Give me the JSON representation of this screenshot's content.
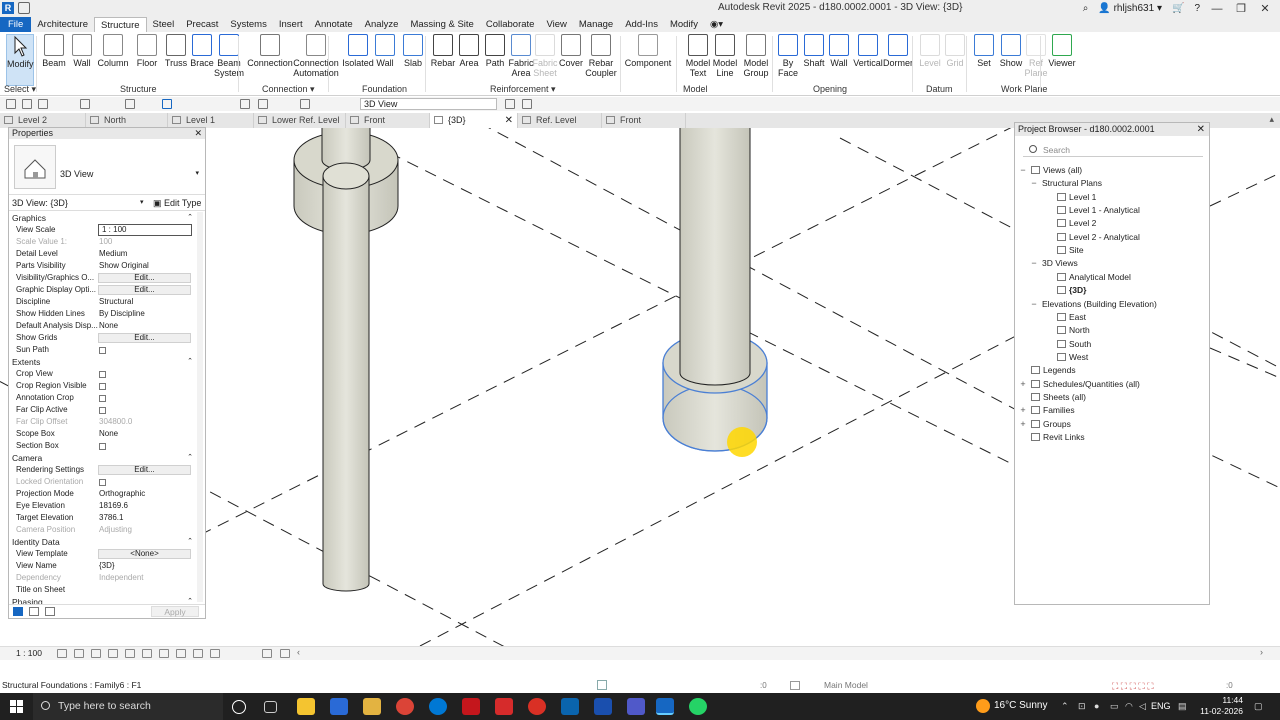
{
  "window": {
    "title": "Autodesk Revit 2025 - d180.0002.0001 - 3D View: {3D}",
    "user": "rhljsh631"
  },
  "menu": [
    "File",
    "Architecture",
    "Structure",
    "Steel",
    "Precast",
    "Systems",
    "Insert",
    "Annotate",
    "Analyze",
    "Massing & Site",
    "Collaborate",
    "View",
    "Manage",
    "Add-Ins",
    "Modify"
  ],
  "ribbon": {
    "tools": [
      {
        "label": "Modify",
        "label2": ""
      },
      {
        "label": "Beam",
        "label2": ""
      },
      {
        "label": "Wall",
        "label2": ""
      },
      {
        "label": "Column",
        "label2": ""
      },
      {
        "label": "Floor",
        "label2": ""
      },
      {
        "label": "Truss",
        "label2": ""
      },
      {
        "label": "Brace",
        "label2": ""
      },
      {
        "label": "Beam",
        "label2": "System"
      },
      {
        "label": "Connection",
        "label2": ""
      },
      {
        "label": "Connection",
        "label2": "Automation"
      },
      {
        "label": "Isolated",
        "label2": ""
      },
      {
        "label": "Wall",
        "label2": ""
      },
      {
        "label": "Slab",
        "label2": ""
      },
      {
        "label": "Rebar",
        "label2": ""
      },
      {
        "label": "Area",
        "label2": ""
      },
      {
        "label": "Path",
        "label2": ""
      },
      {
        "label": "Fabric",
        "label2": "Area"
      },
      {
        "label": "Fabric",
        "label2": "Sheet"
      },
      {
        "label": "Cover",
        "label2": ""
      },
      {
        "label": "Rebar",
        "label2": "Coupler"
      },
      {
        "label": "Component",
        "label2": ""
      },
      {
        "label": "Model",
        "label2": "Text"
      },
      {
        "label": "Model",
        "label2": "Line"
      },
      {
        "label": "Model",
        "label2": "Group"
      },
      {
        "label": "By",
        "label2": "Face"
      },
      {
        "label": "Shaft",
        "label2": ""
      },
      {
        "label": "Wall",
        "label2": ""
      },
      {
        "label": "Vertical",
        "label2": ""
      },
      {
        "label": "Dormer",
        "label2": ""
      },
      {
        "label": "Level",
        "label2": ""
      },
      {
        "label": "Grid",
        "label2": ""
      },
      {
        "label": "Set",
        "label2": ""
      },
      {
        "label": "Show",
        "label2": ""
      },
      {
        "label": "Ref",
        "label2": "Plane"
      },
      {
        "label": "Viewer",
        "label2": ""
      }
    ],
    "panels": [
      "Select",
      "Structure",
      "Connection",
      "Foundation",
      "Reinforcement",
      "Model",
      "Opening",
      "Datum",
      "Work Plane"
    ]
  },
  "quick_access": {
    "view_selector": "3D View"
  },
  "view_tabs": [
    "Level 2",
    "North",
    "Level 1",
    "Lower Ref. Level",
    "Front",
    "{3D}",
    "Ref. Level",
    "Front"
  ],
  "properties": {
    "title": "Properties",
    "type_name": "3D View",
    "instance_selector": "3D View: {3D}",
    "edit_type": "Edit Type",
    "rows": [
      {
        "kind": "group",
        "name": "Graphics"
      },
      {
        "name": "View Scale",
        "value": "1 : 100",
        "style": "input"
      },
      {
        "name": "Scale Value    1:",
        "value": "100",
        "dim": true
      },
      {
        "name": "Detail Level",
        "value": "Medium"
      },
      {
        "name": "Parts Visibility",
        "value": "Show Original"
      },
      {
        "name": "Visibility/Graphics O...",
        "value": "Edit...",
        "style": "button"
      },
      {
        "name": "Graphic Display Opti...",
        "value": "Edit...",
        "style": "button"
      },
      {
        "name": "Discipline",
        "value": "Structural"
      },
      {
        "name": "Show Hidden Lines",
        "value": "By Discipline"
      },
      {
        "name": "Default Analysis Disp...",
        "value": "None"
      },
      {
        "name": "Show Grids",
        "value": "Edit...",
        "style": "button"
      },
      {
        "name": "Sun Path",
        "value": "",
        "style": "check"
      },
      {
        "kind": "group",
        "name": "Extents"
      },
      {
        "name": "Crop View",
        "value": "",
        "style": "check"
      },
      {
        "name": "Crop Region Visible",
        "value": "",
        "style": "check"
      },
      {
        "name": "Annotation Crop",
        "value": "",
        "style": "check"
      },
      {
        "name": "Far Clip Active",
        "value": "",
        "style": "check"
      },
      {
        "name": "Far Clip Offset",
        "value": "304800.0",
        "dim": true
      },
      {
        "name": "Scope Box",
        "value": "None"
      },
      {
        "name": "Section Box",
        "value": "",
        "style": "check"
      },
      {
        "kind": "group",
        "name": "Camera"
      },
      {
        "name": "Rendering Settings",
        "value": "Edit...",
        "style": "button"
      },
      {
        "name": "Locked Orientation",
        "value": "",
        "style": "check",
        "dim": true
      },
      {
        "name": "Projection Mode",
        "value": "Orthographic"
      },
      {
        "name": "Eye Elevation",
        "value": "18169.6"
      },
      {
        "name": "Target Elevation",
        "value": "3786.1"
      },
      {
        "name": "Camera Position",
        "value": "Adjusting",
        "dim": true
      },
      {
        "kind": "group",
        "name": "Identity Data"
      },
      {
        "name": "View Template",
        "value": "<None>",
        "style": "button"
      },
      {
        "name": "View Name",
        "value": "{3D}"
      },
      {
        "name": "Dependency",
        "value": "Independent",
        "dim": true
      },
      {
        "name": "Title on Sheet",
        "value": ""
      },
      {
        "kind": "group",
        "name": "Phasing"
      }
    ],
    "apply": "Apply"
  },
  "project_browser": {
    "title": "Project Browser - d180.0002.0001",
    "search_placeholder": "Search",
    "nodes": [
      {
        "label": "Views (all)",
        "level": 0,
        "toggle": "−",
        "icon": true
      },
      {
        "label": "Structural Plans",
        "level": 1,
        "toggle": "−"
      },
      {
        "label": "Level 1",
        "level": 2,
        "icon": true
      },
      {
        "label": "Level 1 - Analytical",
        "level": 2,
        "icon": true
      },
      {
        "label": "Level 2",
        "level": 2,
        "icon": true
      },
      {
        "label": "Level 2 - Analytical",
        "level": 2,
        "icon": true
      },
      {
        "label": "Site",
        "level": 2,
        "icon": true
      },
      {
        "label": "3D Views",
        "level": 1,
        "toggle": "−"
      },
      {
        "label": "Analytical Model",
        "level": 2,
        "icon": true
      },
      {
        "label": "{3D}",
        "level": 2,
        "icon": true,
        "bold": true
      },
      {
        "label": "Elevations (Building Elevation)",
        "level": 1,
        "toggle": "−"
      },
      {
        "label": "East",
        "level": 2,
        "icon": true
      },
      {
        "label": "North",
        "level": 2,
        "icon": true
      },
      {
        "label": "South",
        "level": 2,
        "icon": true
      },
      {
        "label": "West",
        "level": 2,
        "icon": true
      },
      {
        "label": "Legends",
        "level": 0,
        "icon": true
      },
      {
        "label": "Schedules/Quantities (all)",
        "level": 0,
        "toggle": "+",
        "icon": true
      },
      {
        "label": "Sheets (all)",
        "level": 0,
        "icon": true
      },
      {
        "label": "Families",
        "level": 0,
        "toggle": "+",
        "icon": true
      },
      {
        "label": "Groups",
        "level": 0,
        "toggle": "+",
        "icon": true
      },
      {
        "label": "Revit Links",
        "level": 0,
        "icon": true
      }
    ]
  },
  "view_control": {
    "scale": "1 : 100"
  },
  "status": {
    "text": "Structural Foundations : Family6 : F1",
    "workset": "Main Model",
    "zero1": ":0",
    "zero2": ":0"
  },
  "taskbar": {
    "search_placeholder": "Type here to search",
    "weather": "16°C  Sunny",
    "lang": "ENG",
    "time": "11:44",
    "date": "11-02-2026"
  },
  "colors": {
    "accent": "#1667c2",
    "selection": "#4a7fd4",
    "cursor": "#ffd700",
    "concrete": "#d4d4c8"
  }
}
